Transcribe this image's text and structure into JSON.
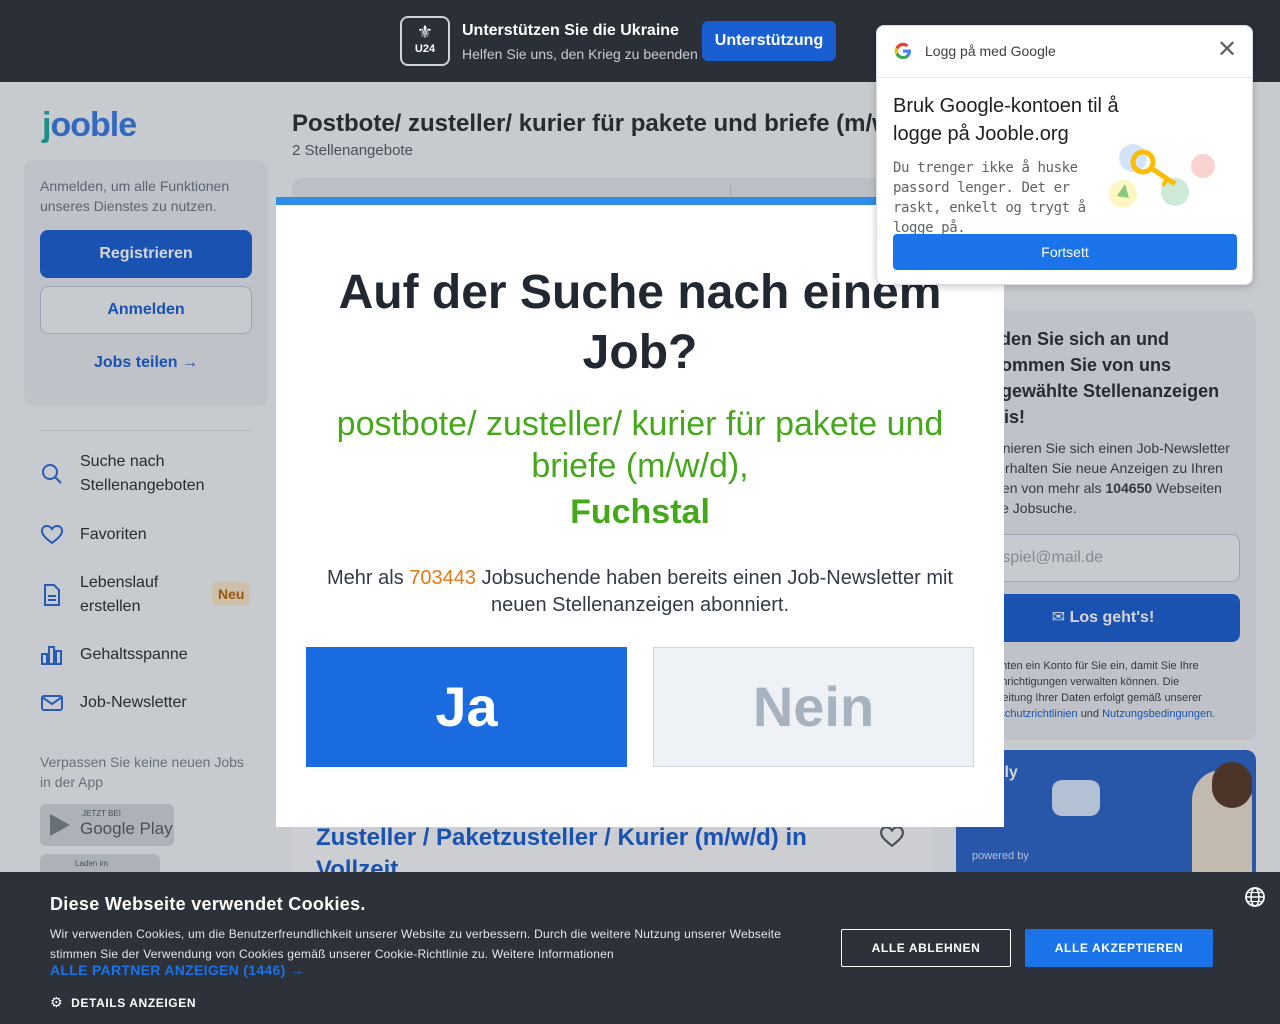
{
  "banner": {
    "badge_label": "U24",
    "title": "Unterstützen Sie die Ukraine",
    "subtitle": "Helfen Sie uns, den Krieg zu beenden",
    "button": "Unterstützung"
  },
  "sidebar": {
    "logo_prefix": "j",
    "logo_rest": "ooble",
    "auth_text": "Anmelden, um alle Funktionen unseres Dienstes zu nutzen.",
    "register": "Registrieren",
    "login": "Anmelden",
    "share": "Jobs teilen",
    "nav": [
      {
        "label": "Suche nach Stellenangeboten",
        "icon": "search-icon"
      },
      {
        "label": "Favoriten",
        "icon": "heart-icon"
      },
      {
        "label": "Lebenslauf erstellen",
        "icon": "document-icon"
      },
      {
        "label": "Gehaltsspanne",
        "icon": "bar-chart-icon"
      },
      {
        "label": "Job-Newsletter",
        "icon": "mail-icon"
      }
    ],
    "new_badge": "Neu",
    "app_text": "Verpassen Sie keine neuen Jobs in der App",
    "gplay_small": "JETZT BEI",
    "gplay_big": "Google Play",
    "appstore_small": "Laden im"
  },
  "main": {
    "title": "Postbote/ zusteller/ kurier für pakete und briefe (m/w/d)",
    "count": "2 Stellenangebote",
    "job_title": "Zusteller / Paketzusteller / Kurier (m/w/d) in Vollzeit"
  },
  "promo": {
    "heading": "Melden Sie sich an und bekommen Sie von uns ausgewählte Stellenanzeigen gratis!",
    "text_before": "Abonnieren Sie sich einen Job-Newsletter und erhalten Sie neue Anzeigen zu Ihren Suchen von mehr als",
    "text_number": "104650",
    "text_after": "Webseiten für die Jobsuche.",
    "email_placeholder": "beispiel@mail.de",
    "button": "Los geht's!",
    "legal_text": "Wir richten ein Konto für Sie ein, damit Sie Ihre Benachrichtigungen verwalten können. Die Verarbeitung Ihrer Daten erfolgt gemäß unserer",
    "legal_link1": "Datenschutzrichtlinien",
    "legal_and": "und",
    "legal_link2": "Nutzungsbedingungen"
  },
  "ad": {
    "brand": "Jobly",
    "powered": "powered by"
  },
  "modal": {
    "title": "Auf der Suche nach einem Job?",
    "query": "postbote/ zusteller/ kurier für pakete und briefe (m/w/d),",
    "city": "Fuchstal",
    "info_before": "Mehr als",
    "info_number": "703443",
    "info_after": "Jobsuchende haben bereits einen Job-Newsletter mit neuen Stellenanzeigen abonniert.",
    "yes": "Ja",
    "no": "Nein"
  },
  "google_popup": {
    "logo": "G",
    "header": "Logg på med Google",
    "title": "Bruk Google-kontoen til å logge på Jooble.org",
    "text": "Du trenger ikke å huske passord lenger. Det er raskt, enkelt og trygt å logge på.",
    "button": "Fortsett"
  },
  "cookie": {
    "title": "Diese Webseite verwendet Cookies.",
    "text": "Wir verwenden Cookies, um die Benutzerfreundlichkeit unserer Website zu verbessern. Durch die weitere Nutzung unserer Webseite stimmen Sie der Verwendung von Cookies gemäß unserer Cookie-Richtlinie zu. Weitere Informationen",
    "partners": "ALLE PARTNER ANZEIGEN (1446) →",
    "details": "DETAILS ANZEIGEN",
    "reject": "ALLE ABLEHNEN",
    "accept": "ALLE AKZEPTIEREN"
  },
  "colors": {
    "primary": "#1a5fd1",
    "green": "#45a81b",
    "orange": "#e07a16",
    "google_blue": "#1a73e8"
  }
}
